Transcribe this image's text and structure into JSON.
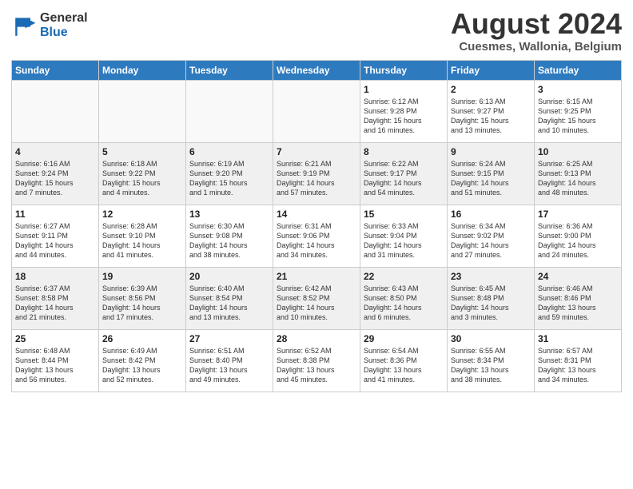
{
  "header": {
    "logo": {
      "general": "General",
      "blue": "Blue"
    },
    "title": "August 2024",
    "location": "Cuesmes, Wallonia, Belgium"
  },
  "weekdays": [
    "Sunday",
    "Monday",
    "Tuesday",
    "Wednesday",
    "Thursday",
    "Friday",
    "Saturday"
  ],
  "weeks": [
    [
      {
        "day": "",
        "info": ""
      },
      {
        "day": "",
        "info": ""
      },
      {
        "day": "",
        "info": ""
      },
      {
        "day": "",
        "info": ""
      },
      {
        "day": "1",
        "info": "Sunrise: 6:12 AM\nSunset: 9:28 PM\nDaylight: 15 hours\nand 16 minutes."
      },
      {
        "day": "2",
        "info": "Sunrise: 6:13 AM\nSunset: 9:27 PM\nDaylight: 15 hours\nand 13 minutes."
      },
      {
        "day": "3",
        "info": "Sunrise: 6:15 AM\nSunset: 9:25 PM\nDaylight: 15 hours\nand 10 minutes."
      }
    ],
    [
      {
        "day": "4",
        "info": "Sunrise: 6:16 AM\nSunset: 9:24 PM\nDaylight: 15 hours\nand 7 minutes."
      },
      {
        "day": "5",
        "info": "Sunrise: 6:18 AM\nSunset: 9:22 PM\nDaylight: 15 hours\nand 4 minutes."
      },
      {
        "day": "6",
        "info": "Sunrise: 6:19 AM\nSunset: 9:20 PM\nDaylight: 15 hours\nand 1 minute."
      },
      {
        "day": "7",
        "info": "Sunrise: 6:21 AM\nSunset: 9:19 PM\nDaylight: 14 hours\nand 57 minutes."
      },
      {
        "day": "8",
        "info": "Sunrise: 6:22 AM\nSunset: 9:17 PM\nDaylight: 14 hours\nand 54 minutes."
      },
      {
        "day": "9",
        "info": "Sunrise: 6:24 AM\nSunset: 9:15 PM\nDaylight: 14 hours\nand 51 minutes."
      },
      {
        "day": "10",
        "info": "Sunrise: 6:25 AM\nSunset: 9:13 PM\nDaylight: 14 hours\nand 48 minutes."
      }
    ],
    [
      {
        "day": "11",
        "info": "Sunrise: 6:27 AM\nSunset: 9:11 PM\nDaylight: 14 hours\nand 44 minutes."
      },
      {
        "day": "12",
        "info": "Sunrise: 6:28 AM\nSunset: 9:10 PM\nDaylight: 14 hours\nand 41 minutes."
      },
      {
        "day": "13",
        "info": "Sunrise: 6:30 AM\nSunset: 9:08 PM\nDaylight: 14 hours\nand 38 minutes."
      },
      {
        "day": "14",
        "info": "Sunrise: 6:31 AM\nSunset: 9:06 PM\nDaylight: 14 hours\nand 34 minutes."
      },
      {
        "day": "15",
        "info": "Sunrise: 6:33 AM\nSunset: 9:04 PM\nDaylight: 14 hours\nand 31 minutes."
      },
      {
        "day": "16",
        "info": "Sunrise: 6:34 AM\nSunset: 9:02 PM\nDaylight: 14 hours\nand 27 minutes."
      },
      {
        "day": "17",
        "info": "Sunrise: 6:36 AM\nSunset: 9:00 PM\nDaylight: 14 hours\nand 24 minutes."
      }
    ],
    [
      {
        "day": "18",
        "info": "Sunrise: 6:37 AM\nSunset: 8:58 PM\nDaylight: 14 hours\nand 21 minutes."
      },
      {
        "day": "19",
        "info": "Sunrise: 6:39 AM\nSunset: 8:56 PM\nDaylight: 14 hours\nand 17 minutes."
      },
      {
        "day": "20",
        "info": "Sunrise: 6:40 AM\nSunset: 8:54 PM\nDaylight: 14 hours\nand 13 minutes."
      },
      {
        "day": "21",
        "info": "Sunrise: 6:42 AM\nSunset: 8:52 PM\nDaylight: 14 hours\nand 10 minutes."
      },
      {
        "day": "22",
        "info": "Sunrise: 6:43 AM\nSunset: 8:50 PM\nDaylight: 14 hours\nand 6 minutes."
      },
      {
        "day": "23",
        "info": "Sunrise: 6:45 AM\nSunset: 8:48 PM\nDaylight: 14 hours\nand 3 minutes."
      },
      {
        "day": "24",
        "info": "Sunrise: 6:46 AM\nSunset: 8:46 PM\nDaylight: 13 hours\nand 59 minutes."
      }
    ],
    [
      {
        "day": "25",
        "info": "Sunrise: 6:48 AM\nSunset: 8:44 PM\nDaylight: 13 hours\nand 56 minutes."
      },
      {
        "day": "26",
        "info": "Sunrise: 6:49 AM\nSunset: 8:42 PM\nDaylight: 13 hours\nand 52 minutes."
      },
      {
        "day": "27",
        "info": "Sunrise: 6:51 AM\nSunset: 8:40 PM\nDaylight: 13 hours\nand 49 minutes."
      },
      {
        "day": "28",
        "info": "Sunrise: 6:52 AM\nSunset: 8:38 PM\nDaylight: 13 hours\nand 45 minutes."
      },
      {
        "day": "29",
        "info": "Sunrise: 6:54 AM\nSunset: 8:36 PM\nDaylight: 13 hours\nand 41 minutes."
      },
      {
        "day": "30",
        "info": "Sunrise: 6:55 AM\nSunset: 8:34 PM\nDaylight: 13 hours\nand 38 minutes."
      },
      {
        "day": "31",
        "info": "Sunrise: 6:57 AM\nSunset: 8:31 PM\nDaylight: 13 hours\nand 34 minutes."
      }
    ]
  ]
}
